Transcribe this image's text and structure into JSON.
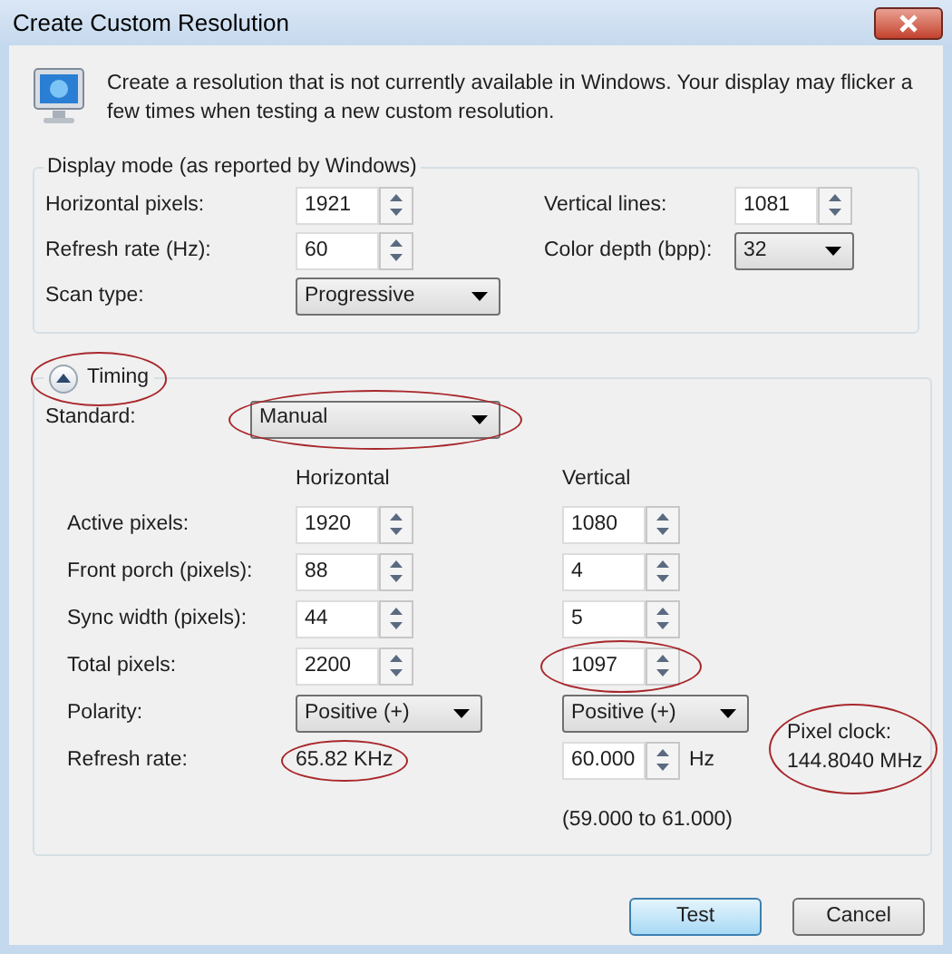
{
  "window": {
    "title": "Create Custom Resolution"
  },
  "description": "Create a resolution that is not currently available in Windows. Your display may flicker a few times when testing a new custom resolution.",
  "display_mode": {
    "title": "Display mode (as reported by Windows)",
    "fields": [
      {
        "label": "Horizontal pixels:",
        "value": "1921",
        "kind": "spin"
      },
      {
        "label": "Vertical lines:",
        "value": "1081",
        "kind": "spin"
      },
      {
        "label": "Refresh rate (Hz):",
        "value": "60",
        "kind": "spin"
      },
      {
        "label": "Color depth (bpp):",
        "value": "32",
        "kind": "dropdown"
      },
      {
        "label": "Scan type:",
        "value": "Progressive",
        "kind": "dropdown"
      }
    ]
  },
  "timing": {
    "label": "Timing",
    "expanded": true,
    "highlighted": true,
    "standard": {
      "label": "Standard:",
      "value": "Manual",
      "highlighted": true
    },
    "columns": [
      "Horizontal",
      "Vertical"
    ],
    "rows": [
      {
        "label": "Active pixels:",
        "horizontal": {
          "kind": "spin",
          "value": "1920"
        },
        "vertical": {
          "kind": "spin",
          "value": "1080"
        }
      },
      {
        "label": "Front porch (pixels):",
        "horizontal": {
          "kind": "spin",
          "value": "88"
        },
        "vertical": {
          "kind": "spin",
          "value": "4"
        }
      },
      {
        "label": "Sync width (pixels):",
        "horizontal": {
          "kind": "spin",
          "value": "44"
        },
        "vertical": {
          "kind": "spin",
          "value": "5"
        }
      },
      {
        "label": "Total pixels:",
        "horizontal": {
          "kind": "spin",
          "value": "2200"
        },
        "vertical": {
          "kind": "spin",
          "value": "1097",
          "highlighted": true
        }
      },
      {
        "label": "Polarity:",
        "horizontal": {
          "kind": "dropdown",
          "value": "Positive (+)"
        },
        "vertical": {
          "kind": "dropdown",
          "value": "Positive (+)"
        }
      },
      {
        "label": "Refresh rate:",
        "horizontal": {
          "kind": "text",
          "value": "65.82 KHz",
          "highlighted": true
        },
        "vertical": {
          "kind": "spin",
          "value": "60.000",
          "unit": "Hz",
          "note": "(59.000 to 61.000)"
        }
      }
    ],
    "pixel_clock": {
      "label": "Pixel clock:",
      "value": "144.8040 MHz",
      "highlighted": true
    }
  },
  "buttons": [
    {
      "label": "Test",
      "default": true
    },
    {
      "label": "Cancel",
      "default": false
    }
  ]
}
